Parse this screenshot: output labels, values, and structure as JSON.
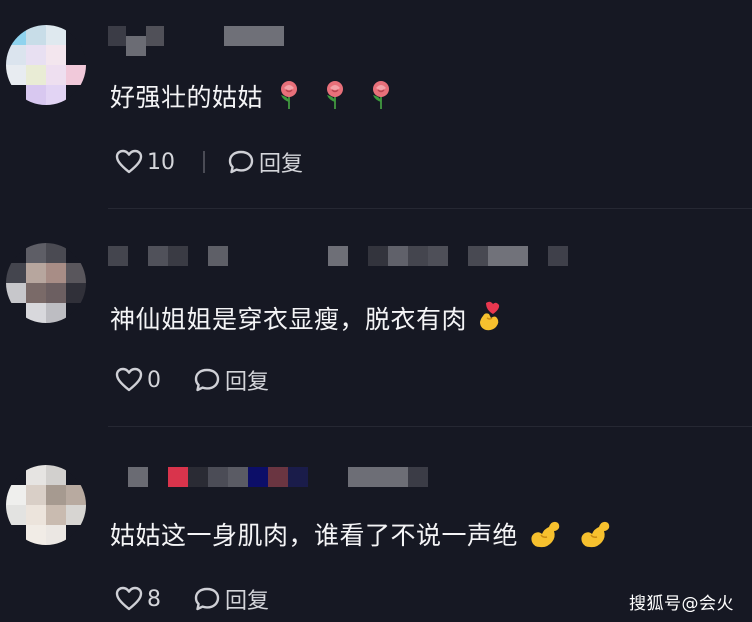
{
  "comments": [
    {
      "text": "好强壮的姑姑",
      "emojis": [
        "rose-emoji",
        "rose-emoji",
        "rose-emoji"
      ],
      "likes": "10",
      "reply_label": "回复"
    },
    {
      "text": "神仙姐姐是穿衣显瘦，脱衣有肉",
      "emojis": [
        "finger-heart-emoji"
      ],
      "likes": "0",
      "reply_label": "回复"
    },
    {
      "text": "姑姑这一身肌肉，谁看了不说一声绝",
      "emojis": [
        "flexed-biceps-emoji",
        "flexed-biceps-emoji"
      ],
      "likes": "8",
      "reply_label": "回复"
    }
  ],
  "watermark": "搜狐号@会火",
  "colors": {
    "background": "#161823",
    "text": "#f4f4f6",
    "secondary_text": "#d4d5da"
  }
}
